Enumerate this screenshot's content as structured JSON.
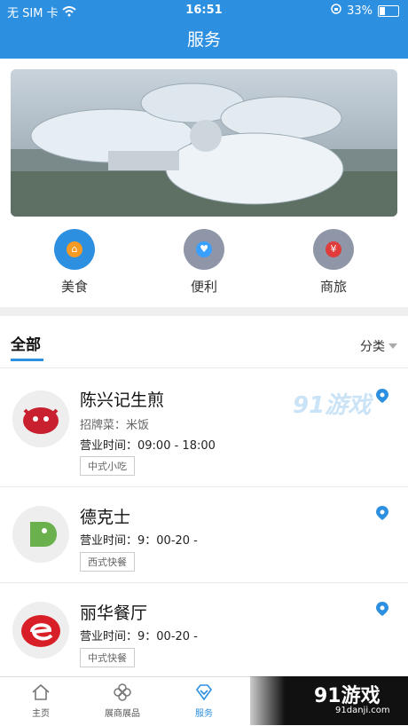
{
  "status": {
    "carrier": "无 SIM 卡",
    "time": "16:51",
    "battery": "33%"
  },
  "header": {
    "title": "服务"
  },
  "categories": [
    {
      "label": "美食",
      "icon": "food-icon",
      "color": "#2c8fe0"
    },
    {
      "label": "便利",
      "icon": "convenience-icon",
      "color": "#3aa0ff"
    },
    {
      "label": "商旅",
      "icon": "business-travel-icon",
      "color": "#e23b3b"
    }
  ],
  "tabs": {
    "all": "全部",
    "sort": "分类"
  },
  "items": [
    {
      "name": "陈兴记生煎",
      "dish": "招牌菜：米饭",
      "hours": "营业时间：09:00 - 18:00",
      "tag": "中式小吃"
    },
    {
      "name": "德克士",
      "hours": "营业时间：9：00-20 -",
      "tag": "西式快餐"
    },
    {
      "name": "丽华餐厅",
      "hours": "营业时间：9：00-20 -",
      "tag": "中式快餐"
    }
  ],
  "watermark": "91游戏",
  "tabbar": [
    {
      "label": "主页"
    },
    {
      "label": "展商展品"
    },
    {
      "label": "服务"
    }
  ],
  "corner": {
    "brand": "91游戏",
    "url": "91danji.com"
  }
}
